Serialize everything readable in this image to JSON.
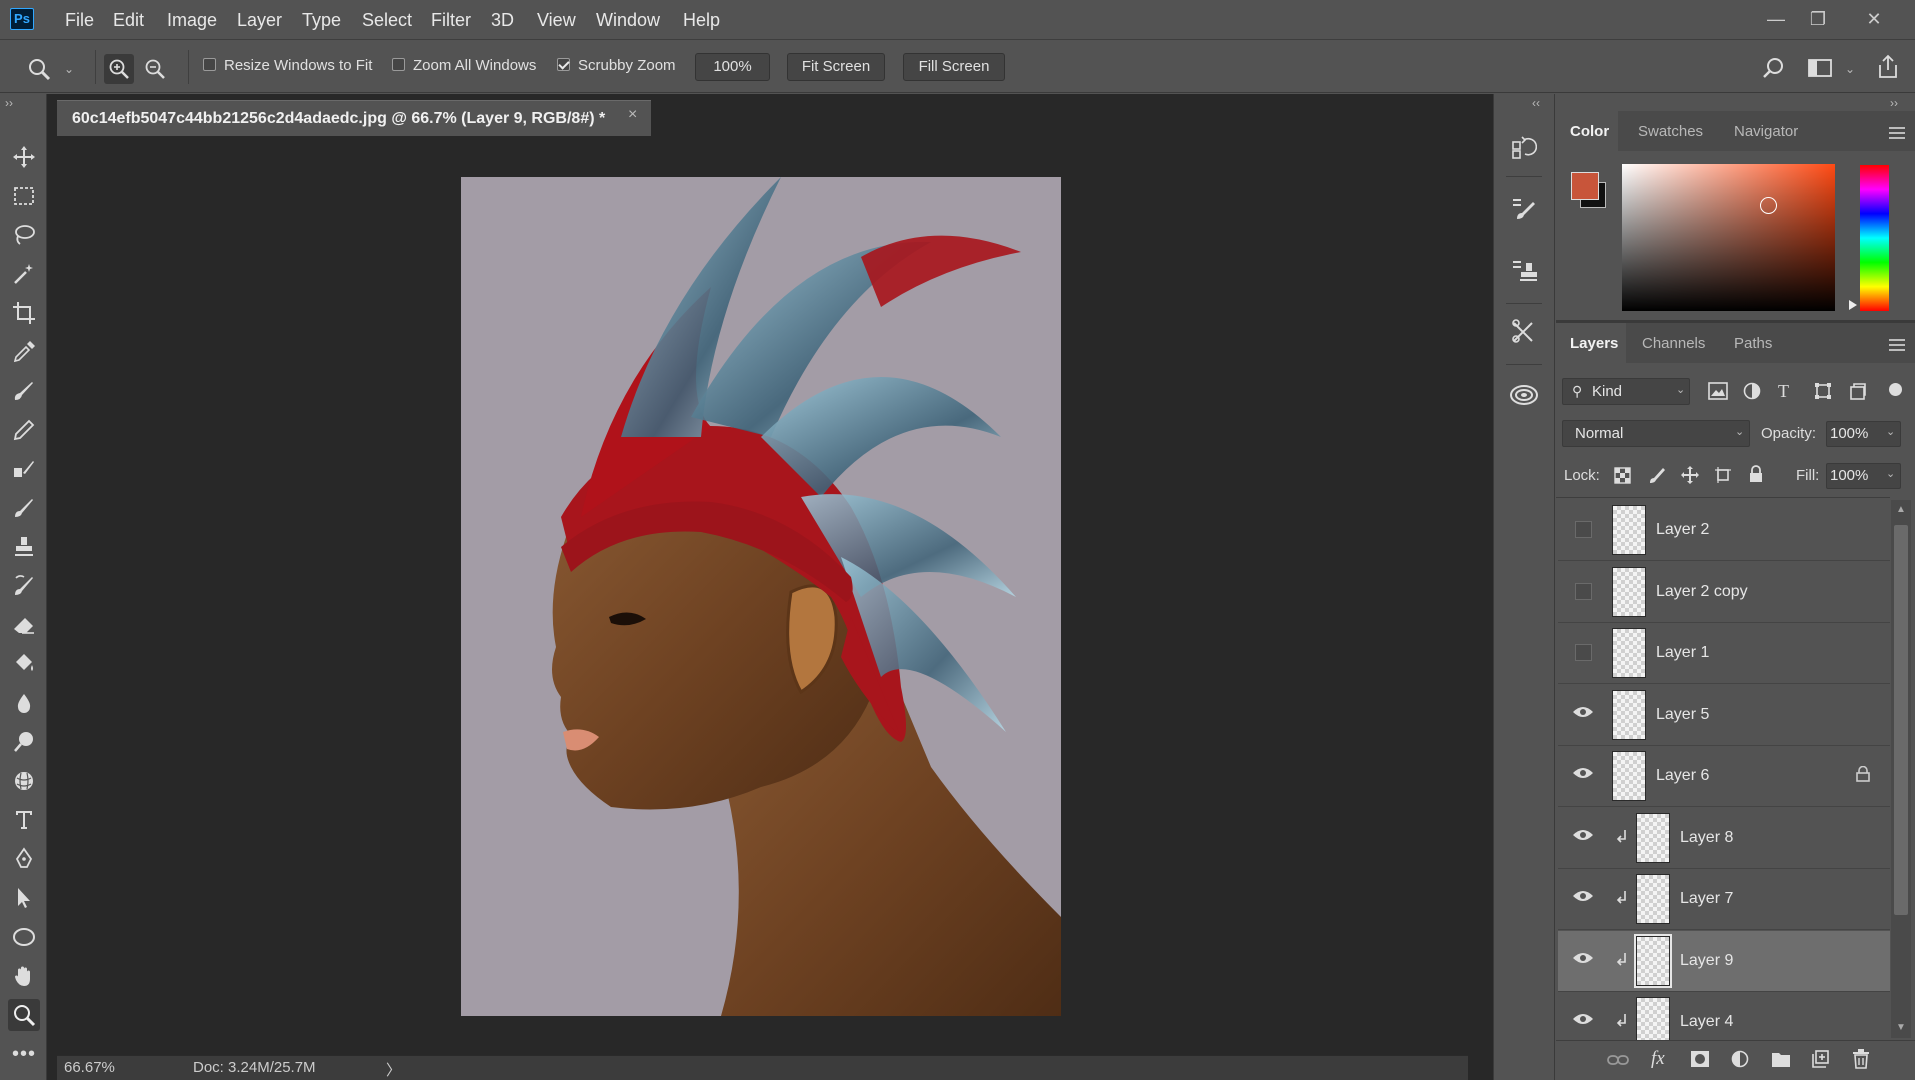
{
  "app": {
    "logo_text": "Ps"
  },
  "menu": [
    "File",
    "Edit",
    "Image",
    "Layer",
    "Type",
    "Select",
    "Filter",
    "3D",
    "View",
    "Window",
    "Help"
  ],
  "options": {
    "resize_windows": {
      "label": "Resize Windows to Fit",
      "checked": false
    },
    "zoom_all": {
      "label": "Zoom All Windows",
      "checked": false
    },
    "scrubby_zoom": {
      "label": "Scrubby Zoom",
      "checked": true
    },
    "zoom_value": "100%",
    "fit_screen": "Fit Screen",
    "fill_screen": "Fill Screen"
  },
  "document": {
    "tab_title": "60c14efb5047c44bb21256c2d4adaedc.jpg @ 66.7% (Layer 9, RGB/8#) *",
    "close": "×"
  },
  "status": {
    "zoom": "66.67%",
    "doc": "Doc: 3.24M/25.7M",
    "arrow": "〉"
  },
  "color_panel": {
    "tabs": [
      "Color",
      "Swatches",
      "Navigator"
    ],
    "foreground": "#c8553a",
    "background": "#111111"
  },
  "layers_panel": {
    "tabs": [
      "Layers",
      "Channels",
      "Paths"
    ],
    "filter_kind": "Kind",
    "blend_mode": "Normal",
    "opacity_label": "Opacity:",
    "opacity_value": "100%",
    "lock_label": "Lock:",
    "fill_label": "Fill:",
    "fill_value": "100%",
    "layers": [
      {
        "name": "Layer 2",
        "visible": false,
        "clipped": false,
        "selected": false,
        "locked": false
      },
      {
        "name": "Layer 2 copy",
        "visible": false,
        "clipped": false,
        "selected": false,
        "locked": false
      },
      {
        "name": "Layer 1",
        "visible": false,
        "clipped": false,
        "selected": false,
        "locked": false
      },
      {
        "name": "Layer 5",
        "visible": true,
        "clipped": false,
        "selected": false,
        "locked": false
      },
      {
        "name": "Layer 6",
        "visible": true,
        "clipped": false,
        "selected": false,
        "locked": true
      },
      {
        "name": "Layer 8",
        "visible": true,
        "clipped": true,
        "selected": false,
        "locked": false
      },
      {
        "name": "Layer 7",
        "visible": true,
        "clipped": true,
        "selected": false,
        "locked": false
      },
      {
        "name": "Layer 9",
        "visible": true,
        "clipped": true,
        "selected": true,
        "locked": false
      },
      {
        "name": "Layer 4",
        "visible": true,
        "clipped": true,
        "selected": false,
        "locked": false
      }
    ]
  },
  "accent": {
    "ps_blue": "#31a8ff",
    "panel_bg": "#535353",
    "doc_bg": "#282828"
  }
}
